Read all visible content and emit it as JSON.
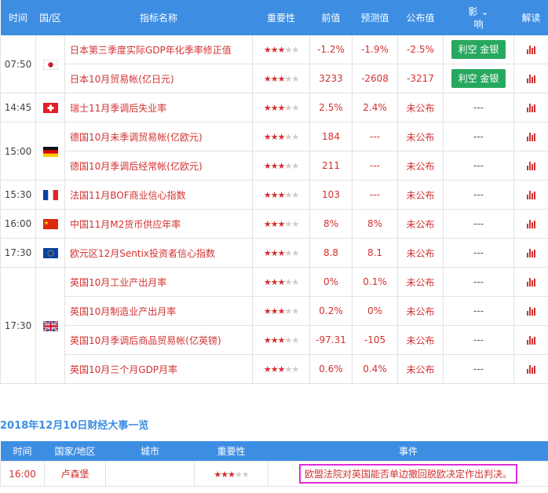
{
  "header": {
    "time": "时间",
    "region": "国/区",
    "indicator": "指标名称",
    "importance": "重要性",
    "previous": "前值",
    "forecast": "预测值",
    "actual": "公布值",
    "impact": "影响",
    "interpret": "解读"
  },
  "groups": [
    {
      "time": "07:50",
      "flag": "japan-flag",
      "rows": [
        {
          "name": "日本第三季度实际GDP年化季率修正值",
          "stars": 3,
          "previous": "-1.2%",
          "forecast": "-1.9%",
          "actual": "-2.5%",
          "impact": "利空 金银"
        },
        {
          "name": "日本10月贸易帐(亿日元)",
          "stars": 3,
          "previous": "3233",
          "forecast": "-2608",
          "actual": "-3217",
          "impact": "利空 金银"
        }
      ]
    },
    {
      "time": "14:45",
      "flag": "switzerland-flag",
      "rows": [
        {
          "name": "瑞士11月季调后失业率",
          "stars": 3,
          "previous": "2.5%",
          "forecast": "2.4%",
          "actual": "未公布",
          "impact": "---"
        }
      ]
    },
    {
      "time": "15:00",
      "flag": "germany-flag",
      "rows": [
        {
          "name": "德国10月未季调贸易帐(亿欧元)",
          "stars": 3,
          "previous": "184",
          "forecast": "---",
          "actual": "未公布",
          "impact": "---"
        },
        {
          "name": "德国10月季调后经常帐(亿欧元)",
          "stars": 3,
          "previous": "211",
          "forecast": "---",
          "actual": "未公布",
          "impact": "---"
        }
      ]
    },
    {
      "time": "15:30",
      "flag": "france-flag",
      "rows": [
        {
          "name": "法国11月BOF商业信心指数",
          "stars": 3,
          "previous": "103",
          "forecast": "---",
          "actual": "未公布",
          "impact": "---"
        }
      ]
    },
    {
      "time": "16:00",
      "flag": "china-flag",
      "rows": [
        {
          "name": "中国11月M2货币供应年率",
          "stars": 3,
          "previous": "8%",
          "forecast": "8%",
          "actual": "未公布",
          "impact": "---"
        }
      ]
    },
    {
      "time": "17:30",
      "flag": "eu-flag",
      "rows": [
        {
          "name": "欧元区12月Sentix投资者信心指数",
          "stars": 3,
          "previous": "8.8",
          "forecast": "8.1",
          "actual": "未公布",
          "impact": "---"
        }
      ]
    },
    {
      "time": "17:30",
      "flag": "uk-flag",
      "rows": [
        {
          "name": "英国10月工业产出月率",
          "stars": 3,
          "previous": "0%",
          "forecast": "0.1%",
          "actual": "未公布",
          "impact": "---"
        },
        {
          "name": "英国10月制造业产出月率",
          "stars": 3,
          "previous": "0.2%",
          "forecast": "0%",
          "actual": "未公布",
          "impact": "---"
        },
        {
          "name": "英国10月季调后商品贸易帐(亿英镑)",
          "stars": 3,
          "previous": "-97.31",
          "forecast": "-105",
          "actual": "未公布",
          "impact": "---"
        },
        {
          "name": "英国10月三个月GDP月率",
          "stars": 3,
          "previous": "0.6%",
          "forecast": "0.4%",
          "actual": "未公布",
          "impact": "---"
        }
      ]
    }
  ],
  "events_section": {
    "title": "2018年12月10日财经大事一览",
    "header": {
      "time": "时间",
      "region": "国家/地区",
      "city": "城市",
      "importance": "重要性",
      "event": "事件"
    },
    "rows": [
      {
        "time": "16:00",
        "region": "卢森堡",
        "city": "",
        "stars": 3,
        "event": "欧盟法院对英国能否单边撤回脱欧决定作出判决。"
      }
    ]
  },
  "colors": {
    "header_bg": "#3d8ee3",
    "accent_red": "#d33131",
    "impact_green": "#27a85f",
    "highlight_border": "#e02bd9"
  }
}
